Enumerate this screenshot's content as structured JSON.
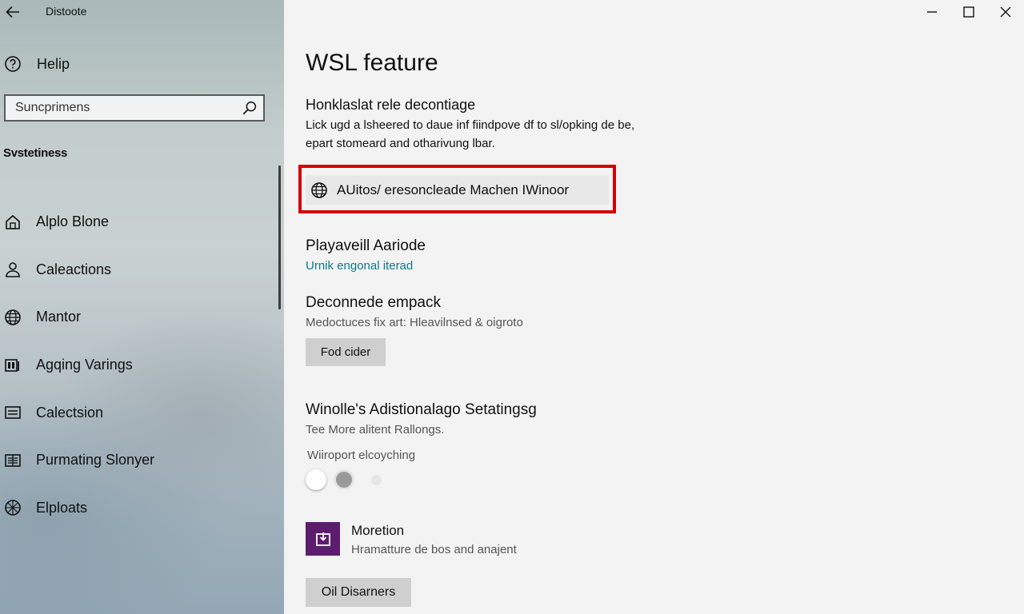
{
  "app": {
    "title": "Distoote"
  },
  "sidebar": {
    "help_label": "Helip",
    "search": {
      "value": "Suncprimens",
      "placeholder": ""
    },
    "section_header": "Svstetiness",
    "items": [
      {
        "label": "Alplo Blone",
        "icon": "home-icon"
      },
      {
        "label": "Caleactions",
        "icon": "person-icon"
      },
      {
        "label": "Mantor",
        "icon": "globe-icon"
      },
      {
        "label": "Agqing Varings",
        "icon": "devices-icon"
      },
      {
        "label": "Calectsion",
        "icon": "window-icon"
      },
      {
        "label": "Purmating Slonyer",
        "icon": "book-icon"
      },
      {
        "label": "Elploats",
        "icon": "network-icon"
      }
    ]
  },
  "main": {
    "title": "WSL feature",
    "subtitle": "Honklaslat rele decontiage",
    "description_line1": "Lick ugd a lsheered to daue inf fiindpove df to sl/opking de be,",
    "description_line2": "epart stomeard and otharivung lbar.",
    "highlight_button": {
      "label": "AUitos/ eresoncleade Machen IWinoor",
      "icon": "globe-icon"
    },
    "section2": {
      "title": "Playaveill Aariode",
      "link": "Urnik engonal iterad"
    },
    "section3": {
      "title": "Deconnede empack",
      "desc": "Medoctuces fix art: Hleavilnsed & oigroto",
      "button": "Fod cider"
    },
    "section4": {
      "title": "Winolle's Adistionalago Setatingsg",
      "desc": "Tee More alitent Rallongs.",
      "option_label": "Wiiroport elcoyching"
    },
    "section5": {
      "title": "Moretion",
      "desc": "Hramatture de bos and anajent",
      "button": "Oil Disarners",
      "tile_color": "#5c1d6e"
    }
  },
  "colors": {
    "highlight": "#d40000",
    "link": "#0a7a8a",
    "accent_tile": "#5c1d6e"
  }
}
